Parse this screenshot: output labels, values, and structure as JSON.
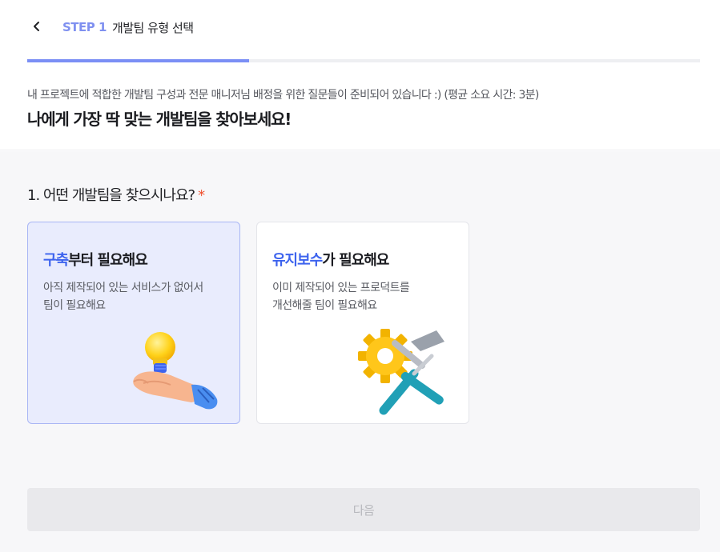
{
  "header": {
    "back_icon": "chevron-left-icon",
    "step_label": "STEP 1",
    "step_name": "개발팀 유형 선택",
    "progress": 0.33,
    "accent_color": "#7b8ff5"
  },
  "intro": {
    "subtitle": "내 프로젝트에 적합한 개발팀 구성과 전문 매니저님 배정을 위한 질문들이 준비되어 있습니다 :) (평균 소요 시간: 3분)",
    "title": "나에게 가장 딱 맞는 개발팀을 찾아보세요!"
  },
  "question": {
    "text": "1. 어떤 개발팀을 찾으시나요?",
    "required_mark": "*"
  },
  "options": [
    {
      "highlight": "구축",
      "title_rest": "부터 필요해요",
      "desc_line1": "아직 제작되어 있는 서비스가 없어서",
      "desc_line2": "팀이 필요해요",
      "icon": "lightbulb-hand-icon",
      "selected": true
    },
    {
      "highlight": "유지보수",
      "title_rest": "가 필요해요",
      "desc_line1": "이미 제작되어 있는 프로덕트를",
      "desc_line2": "개선해줄 팀이 필요해요",
      "icon": "gear-tools-icon",
      "selected": false
    }
  ],
  "footer": {
    "next_label": "다음"
  }
}
